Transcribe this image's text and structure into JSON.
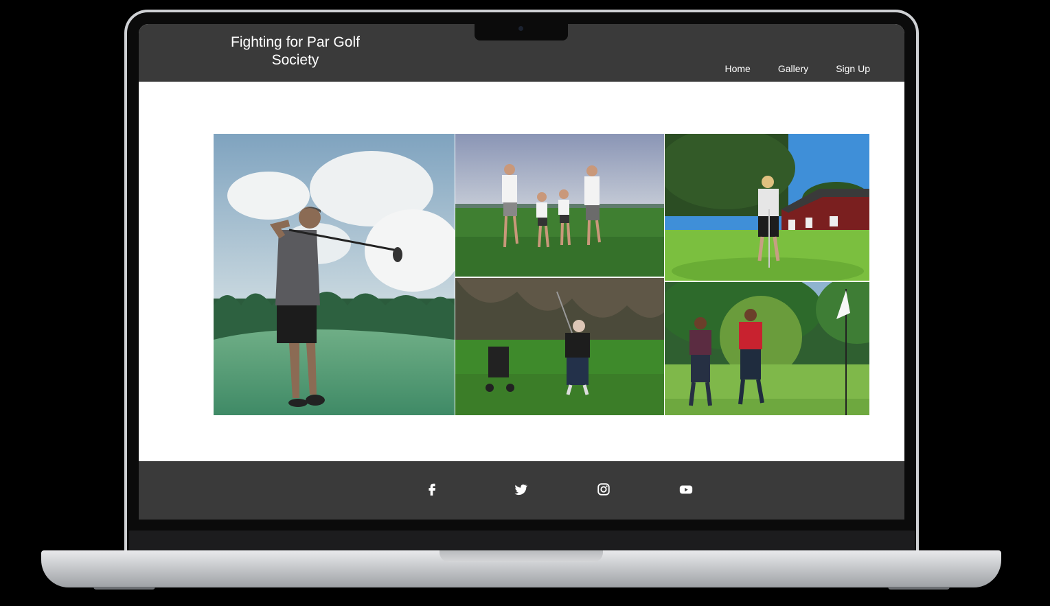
{
  "site": {
    "title": "Fighting for Par Golf Society",
    "nav": [
      "Home",
      "Gallery",
      "Sign Up"
    ]
  },
  "gallery": {
    "photos": [
      "golfer-swing-photo",
      "family-walking-photo",
      "golfer-putting-barn-photo",
      "senior-golfer-swing-photo",
      "two-golfers-flag-photo"
    ]
  },
  "footer": {
    "social": [
      "facebook-icon",
      "twitter-icon",
      "instagram-icon",
      "youtube-icon"
    ]
  },
  "colors": {
    "header": "#3a3a3a",
    "footer": "#3a3a3a",
    "text": "#ffffff"
  }
}
